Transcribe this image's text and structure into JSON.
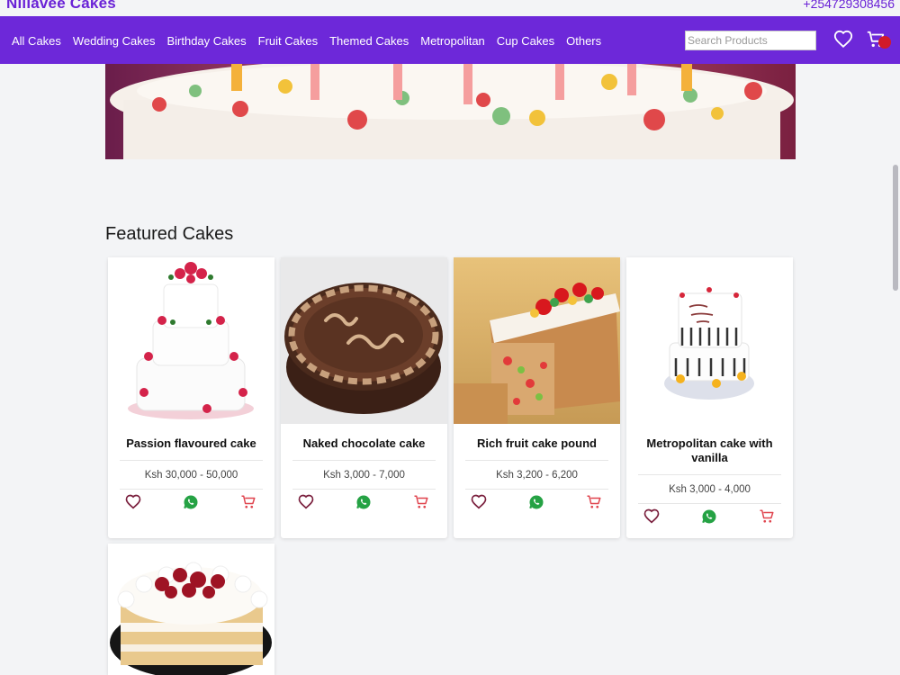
{
  "header": {
    "brand": "Nillavee Cakes",
    "phone": "+254729308456"
  },
  "nav": {
    "links": [
      "All Cakes",
      "Wedding Cakes",
      "Birthday Cakes",
      "Fruit Cakes",
      "Themed Cakes",
      "Metropolitan",
      "Cup Cakes",
      "Others"
    ],
    "search_placeholder": "Search Products"
  },
  "section": {
    "title": "Featured Cakes"
  },
  "products": [
    {
      "name": "Passion flavoured cake",
      "price": "Ksh 30,000 - 50,000"
    },
    {
      "name": "Naked chocolate cake",
      "price": "Ksh 3,000 - 7,000"
    },
    {
      "name": "Rich fruit cake pound",
      "price": "Ksh 3,200 - 6,200"
    },
    {
      "name": "Metropolitan cake with vanilla",
      "price": "Ksh 3,000 - 4,000"
    }
  ],
  "icons": {
    "wishlist": "heart-icon",
    "whatsapp": "whatsapp-icon",
    "cart": "cart-icon"
  },
  "colors": {
    "brand": "#6d28d9",
    "heart": "#7a1f3d",
    "whatsapp": "#25a244",
    "cart": "#e0454f",
    "badge": "#d11a2a"
  }
}
